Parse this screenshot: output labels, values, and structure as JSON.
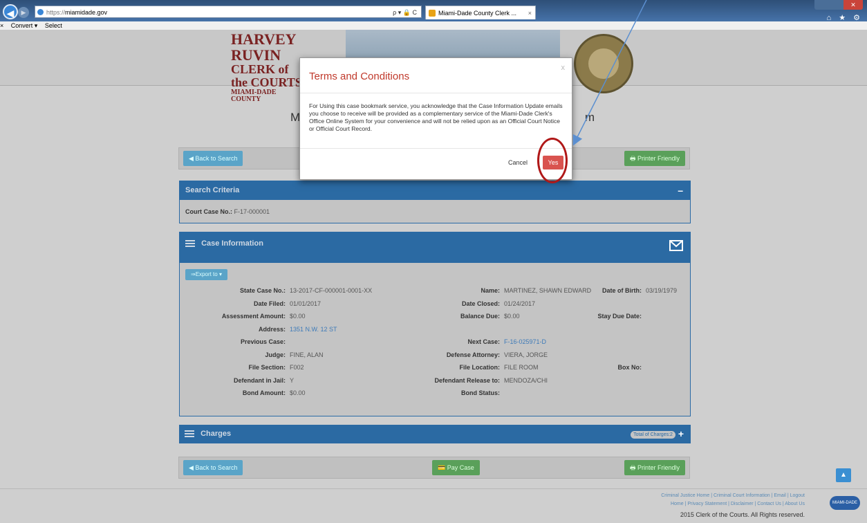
{
  "browser": {
    "url_prefix": "https://",
    "url_host": "miamidade.gov",
    "tab_title": "Miami-Dade County Clerk ...",
    "tab_close": "×",
    "addr_tools": "ρ ▾ 🔒 C",
    "nav_icons": "⌂ ★ ⚙"
  },
  "cmdbar": {
    "close": "×",
    "convert": "Convert ▾",
    "select": "Select"
  },
  "header": {
    "logo_line1": "HARVEY RUVIN",
    "logo_line2": "CLERK of the COURTS",
    "logo_line3": "MIAMI-DADE COUNTY"
  },
  "page_title_left": "M",
  "page_title_right": "m",
  "top_bar": {
    "back": "◀ Back to Search",
    "printer": "🖶 Printer Friendly"
  },
  "search_criteria": {
    "title": "Search Criteria",
    "collapse": "–",
    "label": "Court Case No.:",
    "value": "F-17-000001"
  },
  "case_info": {
    "title": "Case Information",
    "export": "⇒Export to ▾",
    "fields": [
      {
        "label": "State Case No.:",
        "value": "13-2017-CF-000001-0001-XX"
      },
      {
        "label": "Name:",
        "value": "MARTINEZ, SHAWN EDWARD"
      },
      {
        "label": "Date of Birth:",
        "value": "03/19/1979"
      },
      {
        "label": "Date Filed:",
        "value": "01/01/2017"
      },
      {
        "label": "Date Closed:",
        "value": "01/24/2017"
      },
      {
        "label": "Assessment Amount:",
        "value": "$0.00"
      },
      {
        "label": "Balance Due:",
        "value": "$0.00"
      },
      {
        "label": "Stay Due Date:",
        "value": ""
      },
      {
        "label": "Address:",
        "value": "1351 N.W. 12 ST"
      },
      {
        "label": "Previous Case:",
        "value": ""
      },
      {
        "label": "Next Case:",
        "value": "F-16-025971-D"
      },
      {
        "label": "Judge:",
        "value": "FINE, ALAN"
      },
      {
        "label": "Defense Attorney:",
        "value": "VIERA, JORGE"
      },
      {
        "label": "File Section:",
        "value": "F002"
      },
      {
        "label": "File Location:",
        "value": "FILE ROOM"
      },
      {
        "label": "Box No:",
        "value": ""
      },
      {
        "label": "Defendant in Jail:",
        "value": "Y"
      },
      {
        "label": "Defendant Release to:",
        "value": "MENDOZA/CHI"
      },
      {
        "label": "Bond Amount:",
        "value": "$0.00"
      },
      {
        "label": "Bond Status:",
        "value": ""
      }
    ]
  },
  "charges": {
    "title": "Charges",
    "badge": "Total of Charges:2",
    "expand": "+"
  },
  "bottom_bar": {
    "back": "◀ Back to Search",
    "pay": "💳 Pay Case",
    "printer": "🖶 Printer Friendly"
  },
  "modal": {
    "title": "Terms and Conditions",
    "close": "x",
    "body": "For Using this case bookmark service, you acknowledge that the Case Information Update emails you choose to receive will be provided as a complementary service of the Miami-Dade Clerk's Office Online System for your convenience and will not be relied upon as an Official Court Notice or Official Court Record.",
    "cancel": "Cancel",
    "yes": "Yes"
  },
  "footer": {
    "links_row1": "Criminal Justice Home  |  Criminal Court Information  |  Email  |  Logout",
    "links_row2": "Home  |  Privacy Statement  |  Disclaimer  |  Contact Us  |  About Us",
    "copyright": "2015 Clerk of the Courts. All Rights reserved.",
    "badge": "MIAMI-DADE"
  },
  "scroll_top": "▲",
  "colors": {
    "primary": "#2b6aa3",
    "danger": "#d9534f",
    "annotation": "#b01818"
  }
}
